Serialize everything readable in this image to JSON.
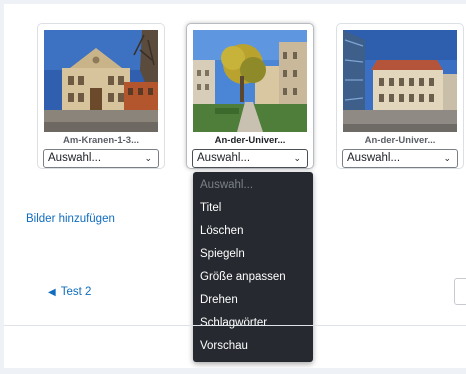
{
  "gallery": {
    "cards": [
      {
        "caption": "Am-Kranen-1-3...",
        "select_value": "Auswahl...",
        "chevron": "chevron-down-icon"
      },
      {
        "caption": "An-der-Univer...",
        "select_value": "Auswahl...",
        "chevron": "chevron-down-icon"
      },
      {
        "caption": "An-der-Univer...",
        "select_value": "Auswahl...",
        "chevron": "chevron-down-icon"
      }
    ]
  },
  "dropdown": {
    "placeholder": "Auswahl...",
    "options": [
      "Titel",
      "Löschen",
      "Spiegeln",
      "Größe anpassen",
      "Drehen",
      "Schlagwörter",
      "Vorschau"
    ]
  },
  "links": {
    "add_images": "Bilder hinzufügen",
    "back_link": "Test 2"
  },
  "colors": {
    "link": "#0f6cbf",
    "menu_background": "#262a30"
  }
}
